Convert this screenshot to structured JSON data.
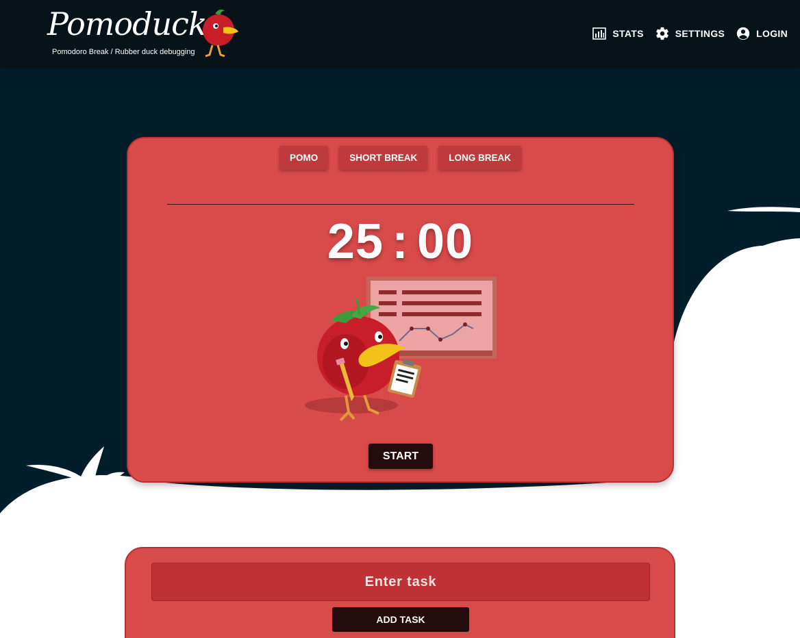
{
  "app": {
    "name": "Pomoduck",
    "tagline": "Pomodoro Break / Rubber duck debugging"
  },
  "nav": {
    "stats": {
      "label": "STATS",
      "icon": "bar-chart-icon"
    },
    "settings": {
      "label": "SETTINGS",
      "icon": "gear-icon"
    },
    "login": {
      "label": "LOGIN",
      "icon": "account-circle-icon"
    }
  },
  "timer": {
    "modes": [
      "POMO",
      "SHORT BREAK",
      "LONG BREAK"
    ],
    "minutes": "25",
    "separator": ":",
    "seconds": "00",
    "start_label": "START"
  },
  "tasks": {
    "input_placeholder": "Enter task",
    "add_label": "ADD TASK"
  },
  "colors": {
    "header": "#071318",
    "background_dark": "#021e2b",
    "card": "#d94a4a",
    "mode_button": "#be3a3c",
    "action_button": "#240c0c"
  }
}
